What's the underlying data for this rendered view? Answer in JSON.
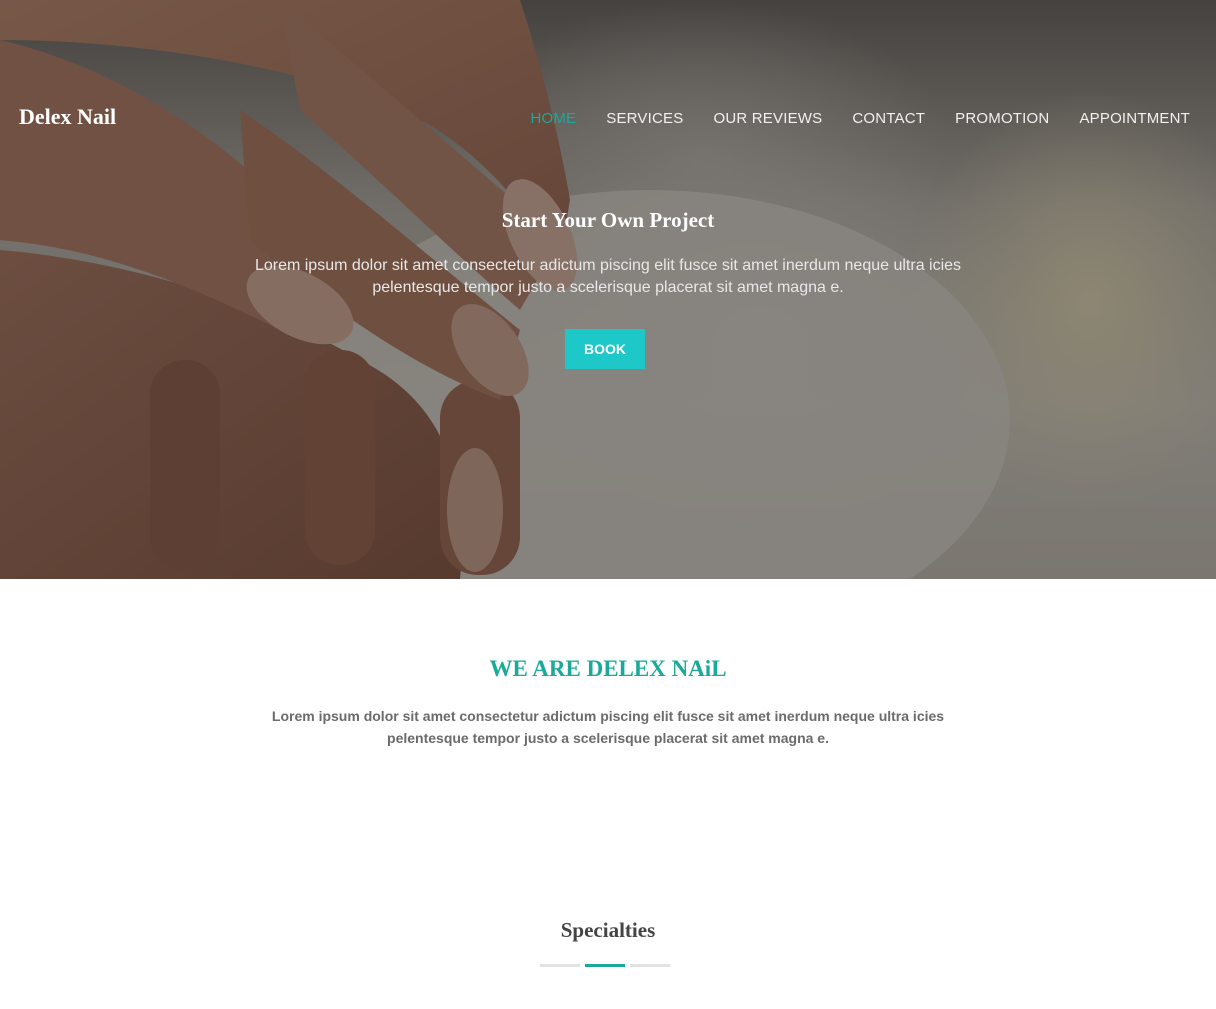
{
  "header": {
    "brand": "Delex Nail",
    "nav": [
      {
        "label": "HOME",
        "active": true
      },
      {
        "label": "SERVICES",
        "active": false
      },
      {
        "label": "OUR REVIEWS",
        "active": false
      },
      {
        "label": "CONTACT",
        "active": false
      },
      {
        "label": "PROMOTION",
        "active": false
      },
      {
        "label": "APPOINTMENT",
        "active": false
      }
    ]
  },
  "hero": {
    "title": "Start Your Own Project",
    "text": "Lorem ipsum dolor sit amet consectetur adictum piscing elit fusce sit amet inerdum neque ultra icies pelentesque tempor justo a scelerisque placerat sit amet magna e.",
    "button": "BOOK"
  },
  "about": {
    "title": "WE ARE DELEX NAiL",
    "text": "Lorem ipsum dolor sit amet consectetur adictum piscing elit fusce sit amet inerdum neque ultra icies pelentesque tempor justo a scelerisque placerat sit amet magna e."
  },
  "specialties": {
    "title": "Specialties"
  },
  "colors": {
    "accent": "#1aa99a",
    "button": "#1ec8c8"
  }
}
